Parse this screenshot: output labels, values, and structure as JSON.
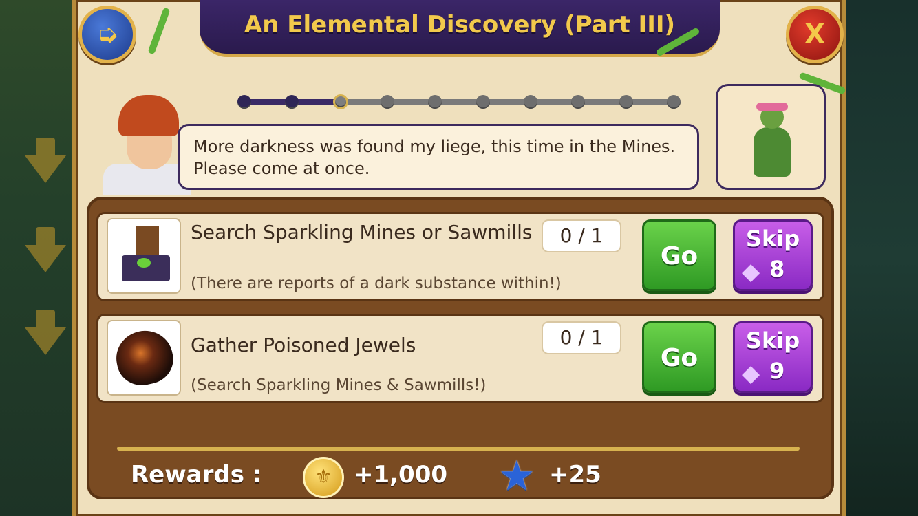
{
  "header": {
    "title": "An Elemental Discovery (Part III)",
    "back_icon": "back-arrow-icon",
    "close_glyph": "X"
  },
  "progress": {
    "total_steps": 10,
    "completed_steps": 2,
    "current_step": 3
  },
  "dialog": {
    "speaker": "advisor",
    "text": "More darkness was found my liege, this time in the Mines. Please come at once.",
    "portrait": "dryad-quest-giver"
  },
  "tasks": [
    {
      "title": "Search Sparkling Mines or Sawmills",
      "subtitle": "(There are reports of a dark substance within!)",
      "progress": "0 / 1",
      "go_label": "Go",
      "skip_label": "Skip",
      "skip_cost": "8",
      "icon": "sparkling-mine-icon"
    },
    {
      "title": "Gather Poisoned Jewels",
      "subtitle": "(Search Sparkling Mines & Sawmills!)",
      "progress": "0 / 1",
      "go_label": "Go",
      "skip_label": "Skip",
      "skip_cost": "9",
      "icon": "poisoned-jewel-icon"
    }
  ],
  "rewards": {
    "label": "Rewards :",
    "coins": "+1,000",
    "xp": "+25"
  },
  "colors": {
    "title_gold": "#f2c94c",
    "go_green": "#3aa82c",
    "skip_purple": "#a83ed8",
    "panel_brown": "#7a4b22"
  }
}
